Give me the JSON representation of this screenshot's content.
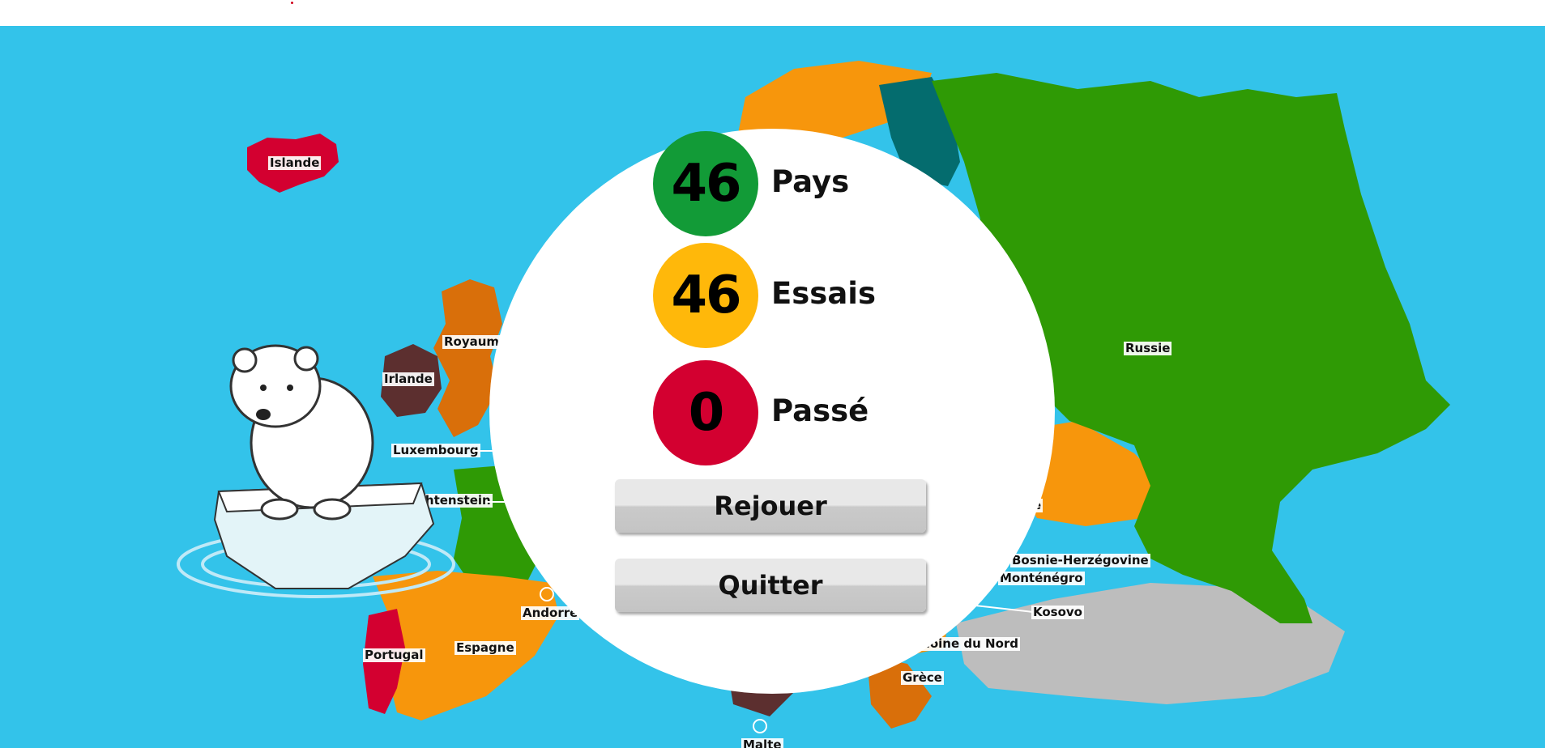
{
  "colors": {
    "sea": "#33c3ea",
    "found": "#129b37",
    "tries": "#ffb80a",
    "skipped": "#d30030"
  },
  "stats": {
    "countries_value": "46",
    "countries_label": "Pays",
    "tries_value": "46",
    "tries_label": "Essais",
    "skipped_value": "0",
    "skipped_label": "Passé"
  },
  "buttons": {
    "replay": "Rejouer",
    "quit": "Quitter"
  },
  "map_labels": {
    "iceland": "Islande",
    "uk": "Royaum",
    "ireland": "Irlande",
    "luxembourg": "Luxembourg",
    "liechtenstein": "chtenstein",
    "andorra": "Andorre",
    "portugal": "Portugal",
    "spain": "Espagne",
    "russia": "Russie",
    "bosnia": "Bosnie-Herzégovine",
    "montenegro": "Monténégro",
    "kosovo": "Kosovo",
    "north_macedonia": "Macédoine du Nord",
    "greece": "Grèce",
    "malta": "Malte",
    "partial": "e"
  },
  "mascot": "polar-bear-on-ice"
}
